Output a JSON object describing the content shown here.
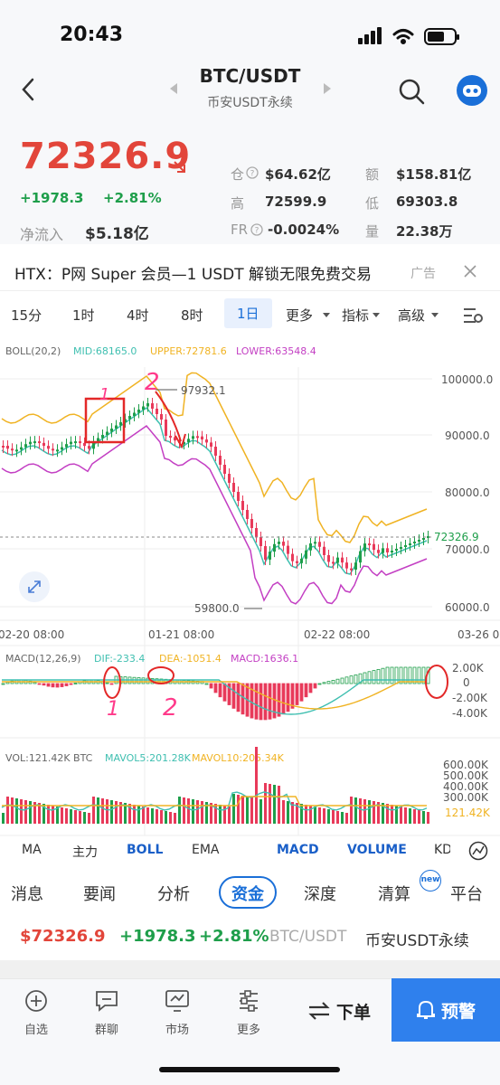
{
  "status": {
    "time": "20:43"
  },
  "header": {
    "pair": "BTC/USDT",
    "subtitle": "币安USDT永续"
  },
  "ticker": {
    "price": "72326.9",
    "change": "+1978.3",
    "change_pct": "+2.81%",
    "netflow_label": "净流入",
    "netflow": "$5.18亿",
    "oi_label": "仓",
    "oi": "$64.62亿",
    "amount_label": "额",
    "amount": "$158.81亿",
    "high_label": "高",
    "high": "72599.9",
    "low_label": "低",
    "low": "69303.8",
    "fr_label": "FR",
    "fr": "-0.0024%",
    "vol_label": "量",
    "vol": "22.38万"
  },
  "banner": {
    "text": "HTX：P网 Super 会员—1 USDT 解锁无限免费交易",
    "ad": "广告"
  },
  "timeframes": {
    "items": [
      "15分",
      "1时",
      "4时",
      "8时",
      "1日",
      "更多",
      "指标",
      "高级"
    ],
    "active": "1日"
  },
  "chart": {
    "boll_label": "BOLL(20,2)",
    "mid_label": "MID:68165.0",
    "upper_label": "UPPER:72781.6",
    "lower_label": "LOWER:63548.4",
    "high_mark": "97932.1",
    "low_mark": "59800.0",
    "y_ticks": [
      "100000.0",
      "90000.0",
      "80000.0",
      "70000.0",
      "60000.0"
    ],
    "last_price": "72326.9",
    "x_ticks": [
      "02-20 08:00",
      "01-21 08:00",
      "02-22 08:00",
      "03-26 0"
    ],
    "annot_box": "1",
    "annot_2": "2",
    "colors": {
      "up": "#1e9e4a",
      "down": "#e83a5a",
      "mid": "#3fbfb0",
      "upper": "#f0b323",
      "lower": "#c33fc3"
    }
  },
  "macd": {
    "label": "MACD(12,26,9)",
    "dif": "DIF:-233.4",
    "dea": "DEA:-1051.4",
    "macd": "MACD:1636.1",
    "y_ticks": [
      "2.00K",
      "0",
      "-2.00K",
      "-4.00K"
    ],
    "annot_1": "1",
    "annot_2": "2"
  },
  "volume": {
    "label": "VOL:121.42K BTC",
    "mavol5": "MAVOL5:201.28K",
    "mavol10": "MAVOL10:205.34K",
    "y_ticks": [
      "600.00K",
      "500.00K",
      "400.00K",
      "300.00K"
    ],
    "last": "121.42K"
  },
  "indicators": [
    "MA",
    "主力",
    "BOLL",
    "EMA",
    "MACD",
    "VOLUME",
    "KD"
  ],
  "info_tabs": [
    "消息",
    "要闻",
    "分析",
    "资金",
    "深度",
    "清算",
    "平台"
  ],
  "info_active": "资金",
  "new_badge": "new",
  "footer_ticker": {
    "price": "$72326.9",
    "change": "+1978.3",
    "pct": "+2.81%",
    "pair": "BTC/USDT",
    "exchange": "币安USDT永续"
  },
  "bottom_nav": {
    "items": [
      "自选",
      "群聊",
      "市场",
      "更多"
    ],
    "order": "下单",
    "alert": "预警"
  }
}
